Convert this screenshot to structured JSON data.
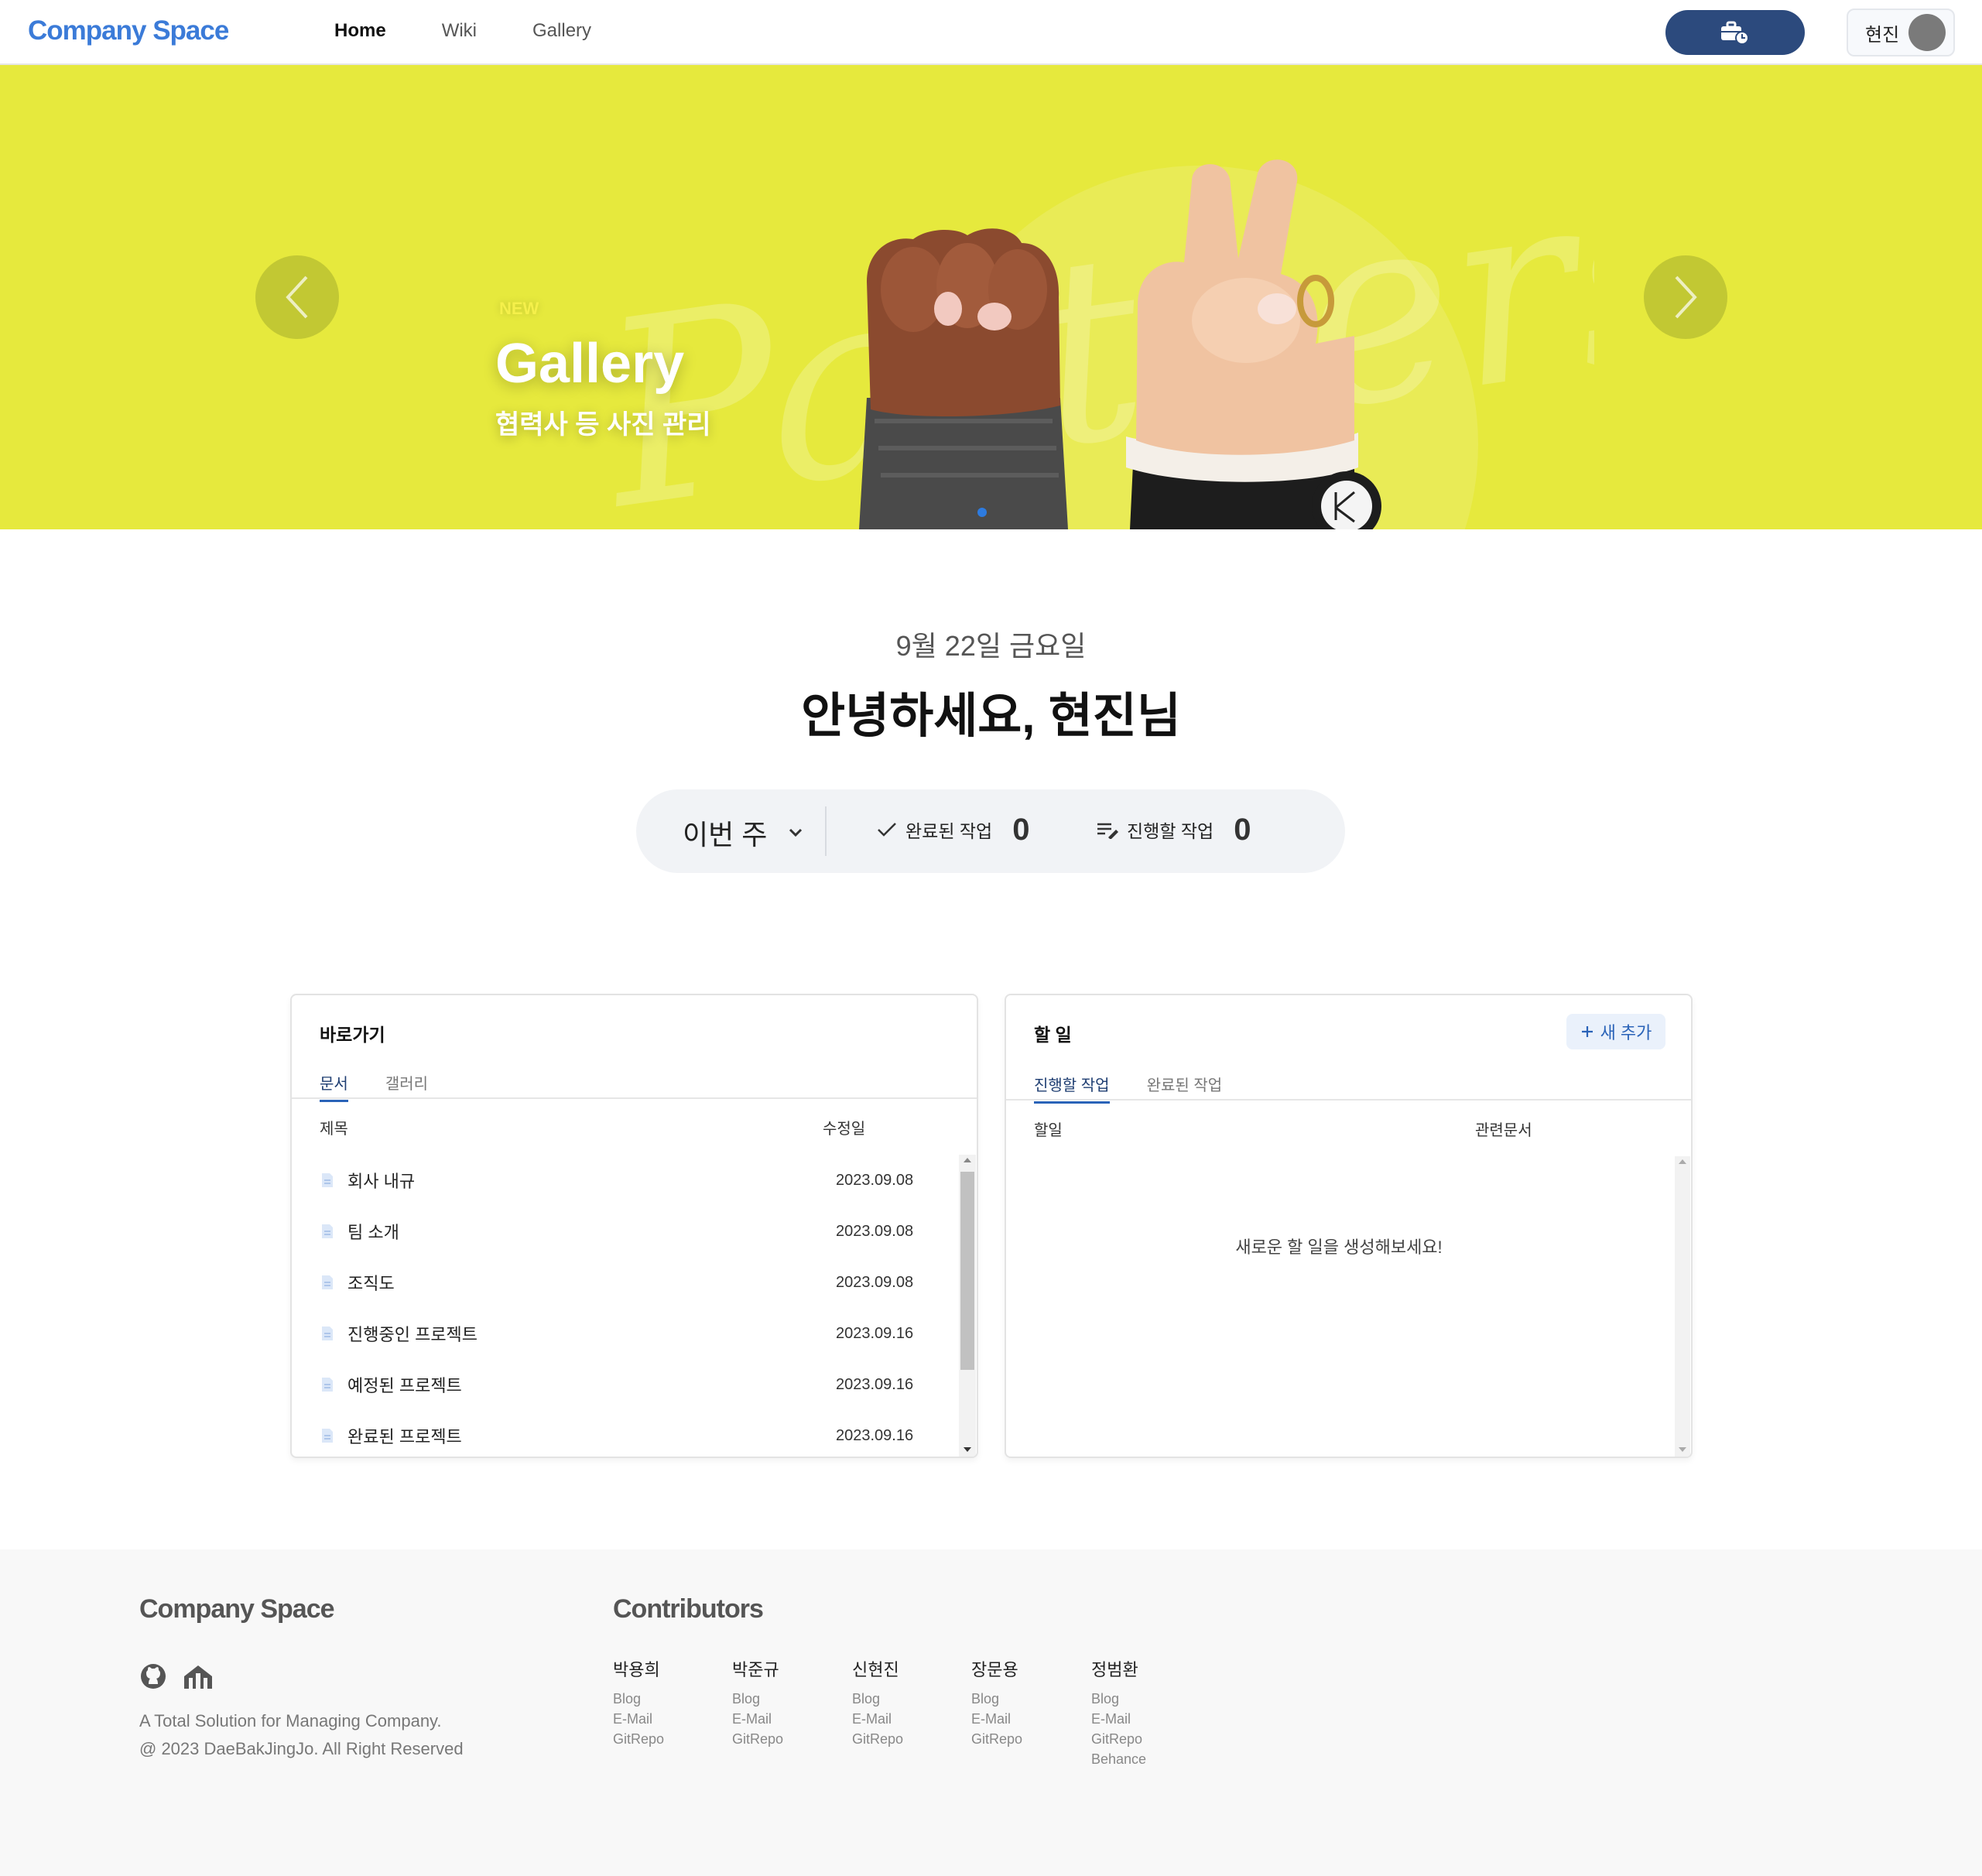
{
  "header": {
    "logo": "Company Space",
    "nav": [
      "Home",
      "Wiki",
      "Gallery"
    ],
    "user_name": "현진"
  },
  "banner": {
    "new_label": "NEW",
    "title": "Gallery",
    "subtitle": "협력사 등 사진 관리",
    "script_text": "Partners",
    "background_color": "#e6e93d"
  },
  "greeting": {
    "date": "9월 22일 금요일",
    "message": "안녕하세요, 현진님"
  },
  "stats": {
    "period": "이번 주",
    "completed_label": "완료된 작업",
    "completed_count": "0",
    "todo_label": "진행할 작업",
    "todo_count": "0"
  },
  "shortcuts": {
    "title": "바로가기",
    "tabs": [
      "문서",
      "갤러리"
    ],
    "columns": [
      "제목",
      "수정일"
    ],
    "rows": [
      {
        "title": "회사 내규",
        "date": "2023.09.08"
      },
      {
        "title": "팀 소개",
        "date": "2023.09.08"
      },
      {
        "title": "조직도",
        "date": "2023.09.08"
      },
      {
        "title": "진행중인 프로젝트",
        "date": "2023.09.16"
      },
      {
        "title": "예정된 프로젝트",
        "date": "2023.09.16"
      },
      {
        "title": "완료된 프로젝트",
        "date": "2023.09.16"
      }
    ]
  },
  "todos": {
    "title": "할 일",
    "add_label": "새 추가",
    "tabs": [
      "진행할 작업",
      "완료된 작업"
    ],
    "columns": [
      "할일",
      "관련문서"
    ],
    "empty_message": "새로운 할 일을 생성해보세요!"
  },
  "footer": {
    "logo": "Company Space",
    "icons": [
      "github-icon",
      "org-icon"
    ],
    "description": "A Total Solution for Managing Company.",
    "copyright": "@ 2023 DaeBakJingJo. All Right Reserved",
    "contributors_title": "Contributors",
    "contributors": [
      {
        "name": "박용희",
        "links": [
          "Blog",
          "E-Mail",
          "GitRepo"
        ]
      },
      {
        "name": "박준규",
        "links": [
          "Blog",
          "E-Mail",
          "GitRepo"
        ]
      },
      {
        "name": "신현진",
        "links": [
          "Blog",
          "E-Mail",
          "GitRepo"
        ]
      },
      {
        "name": "장문용",
        "links": [
          "Blog",
          "E-Mail",
          "GitRepo"
        ]
      },
      {
        "name": "정범환",
        "links": [
          "Blog",
          "E-Mail",
          "GitRepo",
          "Behance"
        ]
      }
    ]
  },
  "colors": {
    "brand": "#3b7bd8",
    "work_button": "#2c4a7d",
    "tab_active": "#2a63b8"
  }
}
